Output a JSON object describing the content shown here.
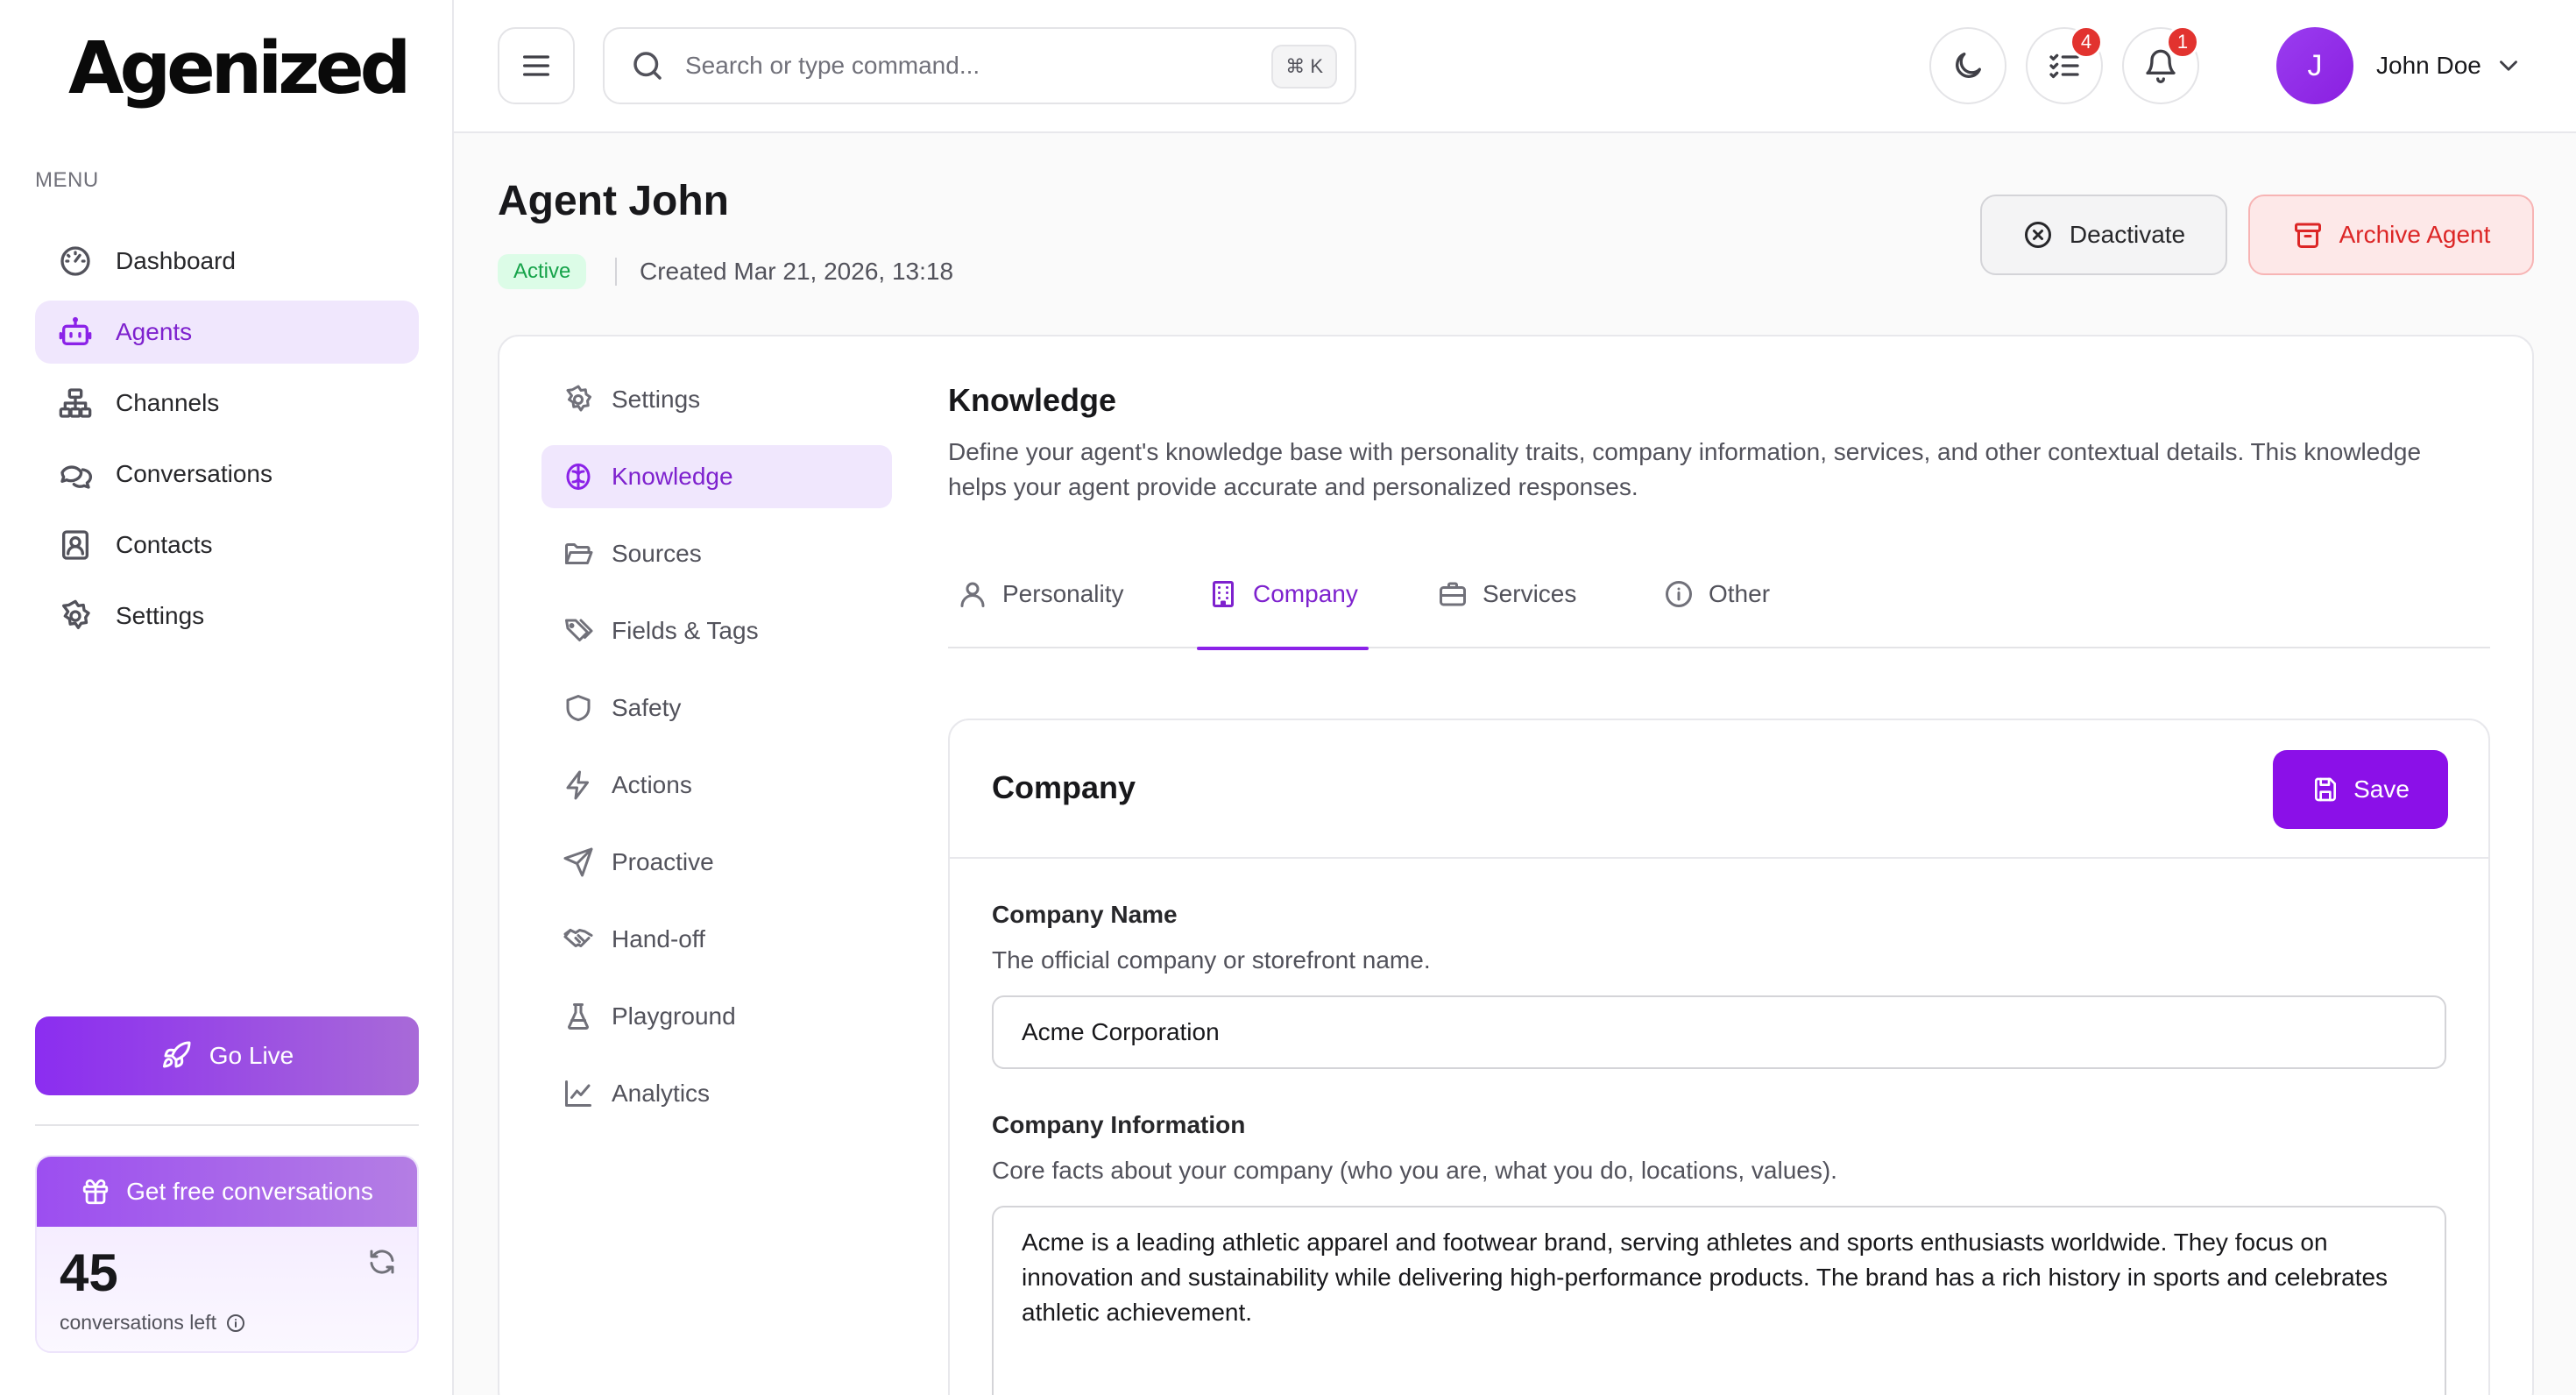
{
  "brand": {
    "logo_text": "Agenized"
  },
  "sidebar": {
    "menu_caption": "MENU",
    "items": [
      {
        "label": "Dashboard",
        "icon": "gauge-icon"
      },
      {
        "label": "Agents",
        "icon": "bot-icon"
      },
      {
        "label": "Channels",
        "icon": "network-icon"
      },
      {
        "label": "Conversations",
        "icon": "messages-icon"
      },
      {
        "label": "Contacts",
        "icon": "contact-card-icon"
      },
      {
        "label": "Settings",
        "icon": "gear-icon"
      }
    ],
    "active_item": "Agents",
    "go_live_label": "Go Live",
    "promo": {
      "header": "Get free conversations",
      "count": "45",
      "caption": "conversations left"
    }
  },
  "topbar": {
    "search_placeholder": "Search or type command...",
    "shortcut": "⌘ K",
    "tasks_badge": "4",
    "notifications_badge": "1",
    "user": {
      "initial": "J",
      "name": "John Doe"
    }
  },
  "page": {
    "title": "Agent John",
    "status": "Active",
    "created": "Created Mar 21, 2026, 13:18",
    "deactivate_label": "Deactivate",
    "archive_label": "Archive Agent"
  },
  "subnav": {
    "items": [
      {
        "label": "Settings",
        "icon": "gear-icon"
      },
      {
        "label": "Knowledge",
        "icon": "brain-icon"
      },
      {
        "label": "Sources",
        "icon": "folder-open-icon"
      },
      {
        "label": "Fields & Tags",
        "icon": "tags-icon"
      },
      {
        "label": "Safety",
        "icon": "shield-icon"
      },
      {
        "label": "Actions",
        "icon": "lightning-icon"
      },
      {
        "label": "Proactive",
        "icon": "send-icon"
      },
      {
        "label": "Hand-off",
        "icon": "handshake-icon"
      },
      {
        "label": "Playground",
        "icon": "flask-icon"
      },
      {
        "label": "Analytics",
        "icon": "chart-line-icon"
      }
    ],
    "active_item": "Knowledge"
  },
  "knowledge": {
    "title": "Knowledge",
    "description": "Define your agent's knowledge base with personality traits, company information, services, and other contextual details. This knowledge helps your agent provide accurate and personalized responses.",
    "tabs": [
      {
        "label": "Personality",
        "icon": "user-icon"
      },
      {
        "label": "Company",
        "icon": "building-icon"
      },
      {
        "label": "Services",
        "icon": "briefcase-icon"
      },
      {
        "label": "Other",
        "icon": "info-icon"
      }
    ],
    "active_tab": "Company"
  },
  "company_form": {
    "title": "Company",
    "save_label": "Save",
    "company_name": {
      "label": "Company Name",
      "hint": "The official company or storefront name.",
      "value": "Acme Corporation"
    },
    "company_info": {
      "label": "Company Information",
      "hint": "Core facts about your company (who you are, what you do, locations, values).",
      "value": "Acme is a leading athletic apparel and footwear brand, serving athletes and sports enthusiasts worldwide. They focus on innovation and sustainability while delivering high-performance products. The brand has a rich history in sports and celebrates athletic achievement."
    }
  },
  "colors": {
    "accent": "#8b10e8",
    "accent_soft": "#f0e7fd",
    "danger": "#dc2626",
    "success": "#16a34a",
    "badge": "#e2332f"
  }
}
